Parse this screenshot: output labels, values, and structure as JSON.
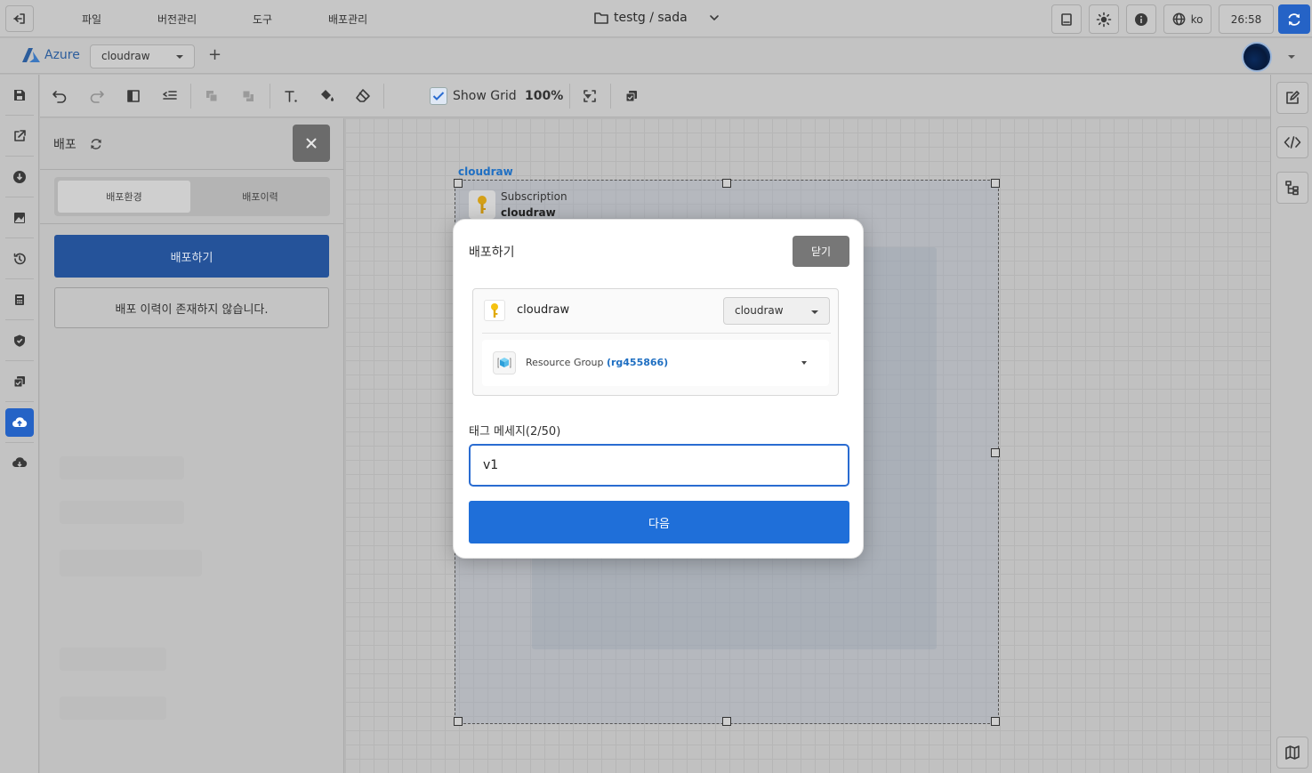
{
  "menu": {
    "items": [
      "파일",
      "버전관리",
      "도구",
      "배포관리"
    ]
  },
  "project": {
    "path": "testg / sada"
  },
  "top_right": {
    "language": "ko",
    "timer": "26:58"
  },
  "subbar": {
    "brand": "Azure",
    "subscription_selected": "cloudraw"
  },
  "toolbar": {
    "show_grid_label": "Show Grid",
    "show_grid_checked": true,
    "zoom": "100%"
  },
  "panel": {
    "title": "배포",
    "tabs": [
      "배포환경",
      "배포이력"
    ],
    "active_tab": "배포환경",
    "deploy_button": "배포하기",
    "empty_message": "배포 이력이 존재하지 않습니다."
  },
  "canvas": {
    "group_label": "cloudraw",
    "subscription_type": "Subscription",
    "subscription_name": "cloudraw"
  },
  "modal": {
    "title": "배포하기",
    "close_label": "닫기",
    "subscription_name": "cloudraw",
    "subscription_select": "cloudraw",
    "resource_group_label": "Resource Group",
    "resource_group_id": "(rg455866)",
    "tag_label": "태그 메세지(2/50)",
    "tag_value": "v1",
    "next_label": "다음"
  },
  "colors": {
    "primary": "#1f6fd9",
    "accent_link": "#1f6fc2",
    "close_button": "#777777"
  }
}
